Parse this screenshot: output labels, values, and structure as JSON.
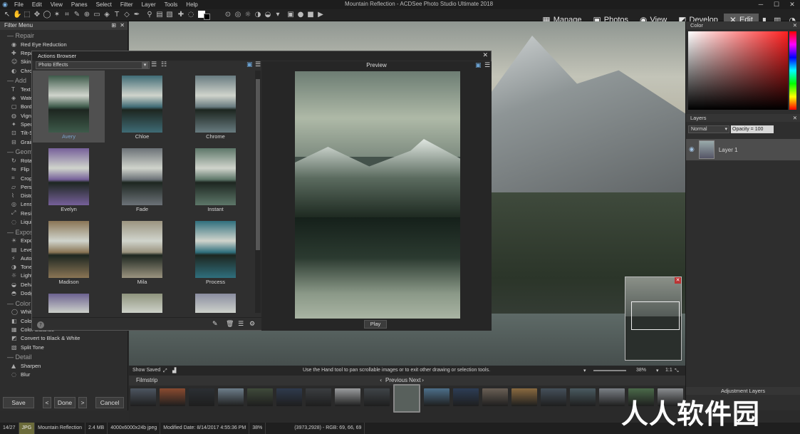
{
  "menu": [
    "File",
    "Edit",
    "View",
    "Panes",
    "Select",
    "Filter",
    "Layer",
    "Tools",
    "Help"
  ],
  "app_title": "Mountain Reflection - ACDSee Photo Studio Ultimate 2018",
  "modes": [
    {
      "icon": "grid-icon",
      "glyph": "▦",
      "label": "Manage"
    },
    {
      "icon": "image-icon",
      "glyph": "▣",
      "label": "Photos"
    },
    {
      "icon": "eye-icon",
      "glyph": "◉",
      "label": "View"
    },
    {
      "icon": "develop-icon",
      "glyph": "◩",
      "label": "Develop"
    },
    {
      "icon": "edit-icon",
      "glyph": "✕",
      "label": "Edit"
    }
  ],
  "filter_panel": {
    "title": "Filter Menu",
    "sections": [
      {
        "name": "Repair",
        "items": [
          "Red Eye Reduction",
          "Repair",
          "Skin",
          "Chrom"
        ]
      },
      {
        "name": "Add",
        "items": [
          "Text",
          "Wate",
          "Bord",
          "Vign",
          "Speci",
          "Tilt-S",
          "Grain"
        ]
      },
      {
        "name": "Geom",
        "items": [
          "Rotat",
          "Flip",
          "Crop",
          "Persp",
          "Disto",
          "Lens",
          "Resiz",
          "Liqui"
        ]
      },
      {
        "name": "Expos",
        "items": [
          "Expo",
          "Level",
          "Auto",
          "Tone",
          "Light",
          "Deha",
          "Dodg"
        ]
      },
      {
        "name": "Color",
        "items": [
          "White",
          "Color EQ",
          "Color Balance",
          "Convert to Black & White",
          "Split Tone"
        ]
      },
      {
        "name": "Detail",
        "items": [
          "Sharpen",
          "Blur"
        ]
      }
    ],
    "save_label": "Save",
    "prev_label": "<",
    "done_label": "Done",
    "next_label": ">",
    "cancel_label": "Cancel"
  },
  "actions_browser": {
    "title": "Actions Browser",
    "category": "Photo Effects",
    "preview_title": "Preview",
    "play_label": "Play",
    "help": "?",
    "effects": [
      {
        "label": "Avery",
        "color": "#3d5a4a"
      },
      {
        "label": "Chloe",
        "color": "#3f6b75"
      },
      {
        "label": "Chrome",
        "color": "#687b80"
      },
      {
        "label": "Evelyn",
        "color": "#76609a"
      },
      {
        "label": "Fade",
        "color": "#6c7278"
      },
      {
        "label": "Instant",
        "color": "#5d7769"
      },
      {
        "label": "Madison",
        "color": "#8a7555"
      },
      {
        "label": "Mila",
        "color": "#9b9480"
      },
      {
        "label": "Process",
        "color": "#2f6f7d"
      },
      {
        "label": "",
        "color": "#6c6290"
      },
      {
        "label": "",
        "color": "#8f947d"
      },
      {
        "label": "",
        "color": "#8a8da0"
      }
    ]
  },
  "canvas_status": {
    "show_saved": "Show Saved",
    "hint": "Use the Hand tool to pan scrollable images or to exit other drawing or selection tools.",
    "zoom": "38%",
    "ratio": "1:1"
  },
  "filmstrip": {
    "title": "Filmstrip",
    "previous": "Previous",
    "next": "Next",
    "thumbs": [
      "#4d5560",
      "#8a4b30",
      "#2b2f33",
      "#6d7d8a",
      "#3f4a3a",
      "#2f3a4d",
      "#3a3d40",
      "#9a9c9e",
      "#3f4448",
      "#58605c",
      "#4d6f8a",
      "#2d3d55",
      "#6a5f55",
      "#8a6a40",
      "#45505a",
      "#4a5a60",
      "#7a7f85",
      "#4b6a4a",
      "#8a8d90"
    ]
  },
  "right_panel": {
    "color_title": "Color",
    "layers_title": "Layers",
    "blend_mode": "Normal",
    "opacity": "Opacity = 100",
    "layer_name": "Layer 1",
    "adjustment_title": "Adjustment Layers"
  },
  "statusbar": {
    "index": "14/27",
    "format": "JPG",
    "filename": "Mountain Reflection",
    "size": "2.4 MB",
    "dims": "4000x6000x24b jpeg",
    "modified": "Modified Date: 8/14/2017 4:55:36 PM",
    "zoom": "38%",
    "coords": "(3973,2928) - RGB: 69, 66, 69"
  },
  "watermark": "人人软件园"
}
